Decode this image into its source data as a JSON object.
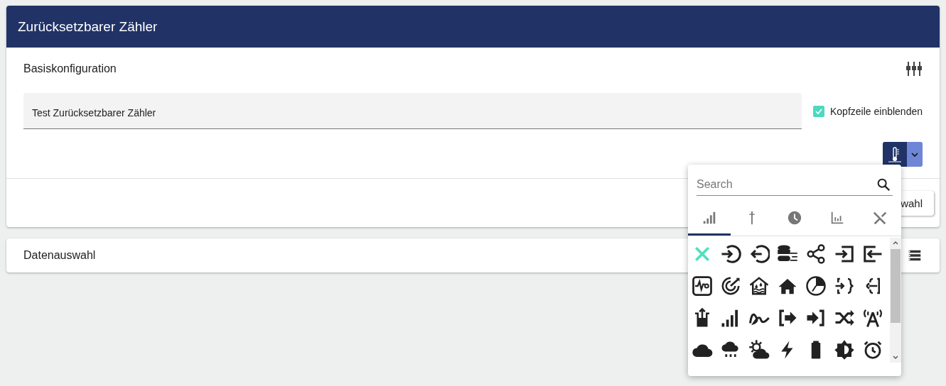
{
  "header": {
    "title": "Zurücksetzbarer Zähler"
  },
  "basic_config": {
    "title": "Basiskonfiguration",
    "name_field": {
      "value": "Test Zurücksetzbarer Zähler"
    },
    "show_header": {
      "label": "Kopfzeile einblenden",
      "checked": true
    },
    "icon_dropdown": {
      "expanded": true
    }
  },
  "partial_button": {
    "label": "wahl"
  },
  "data_section": {
    "title": "Datenauswahl"
  },
  "icon_picker": {
    "search": {
      "placeholder": "Search"
    },
    "tabs": [
      {
        "selected": true
      },
      {
        "selected": false
      },
      {
        "selected": false
      },
      {
        "selected": false
      },
      {
        "selected": false
      }
    ]
  }
}
